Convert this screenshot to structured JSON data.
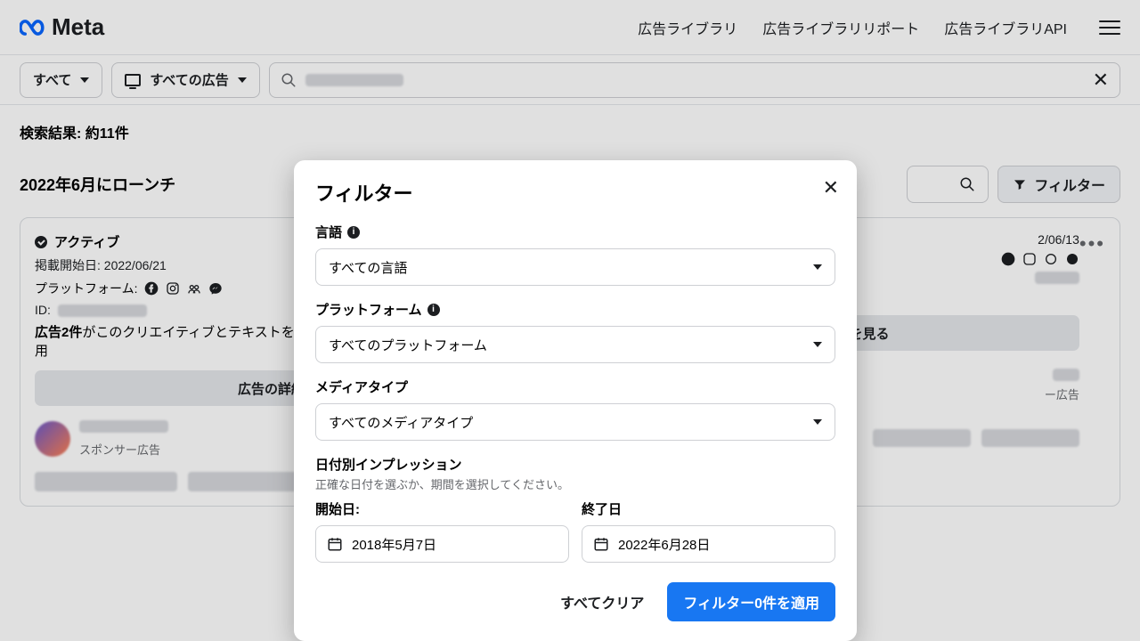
{
  "brand": "Meta",
  "nav": {
    "lib": "広告ライブラリ",
    "report": "広告ライブラリリポート",
    "api": "広告ライブラリAPI"
  },
  "filterbar": {
    "all": "すべて",
    "all_ads": "すべての広告"
  },
  "results": {
    "count_label": "検索結果: 約11件",
    "launch_heading": "2022年6月にローンチ",
    "filter_btn": "フィルター"
  },
  "card1": {
    "status": "アクティブ",
    "start": "掲載開始日: 2022/06/21",
    "platform_label": "プラットフォーム:",
    "id_label": "ID:",
    "sentence_a": "広告2件",
    "sentence_b": "がこのクリエイティブとテキストを",
    "sentence_c": "用",
    "detail": "広告の詳細を見る",
    "sponsor": "スポンサー広告"
  },
  "card2": {
    "start_tail": "2/06/13",
    "detail": "広告の詳細を見る",
    "sponsor_tail": "ー広告"
  },
  "modal": {
    "title": "フィルター",
    "lang_label": "言語",
    "lang_value": "すべての言語",
    "platform_label": "プラットフォーム",
    "platform_value": "すべてのプラットフォーム",
    "media_label": "メディアタイプ",
    "media_value": "すべてのメディアタイプ",
    "impressions_label": "日付別インプレッション",
    "impressions_desc": "正確な日付を選ぶか、期間を選択してください。",
    "start_label": "開始日:",
    "start_value": "2018年5月7日",
    "end_label": "終了日",
    "end_value": "2022年6月28日",
    "clear": "すべてクリア",
    "apply": "フィルター0件を適用"
  }
}
